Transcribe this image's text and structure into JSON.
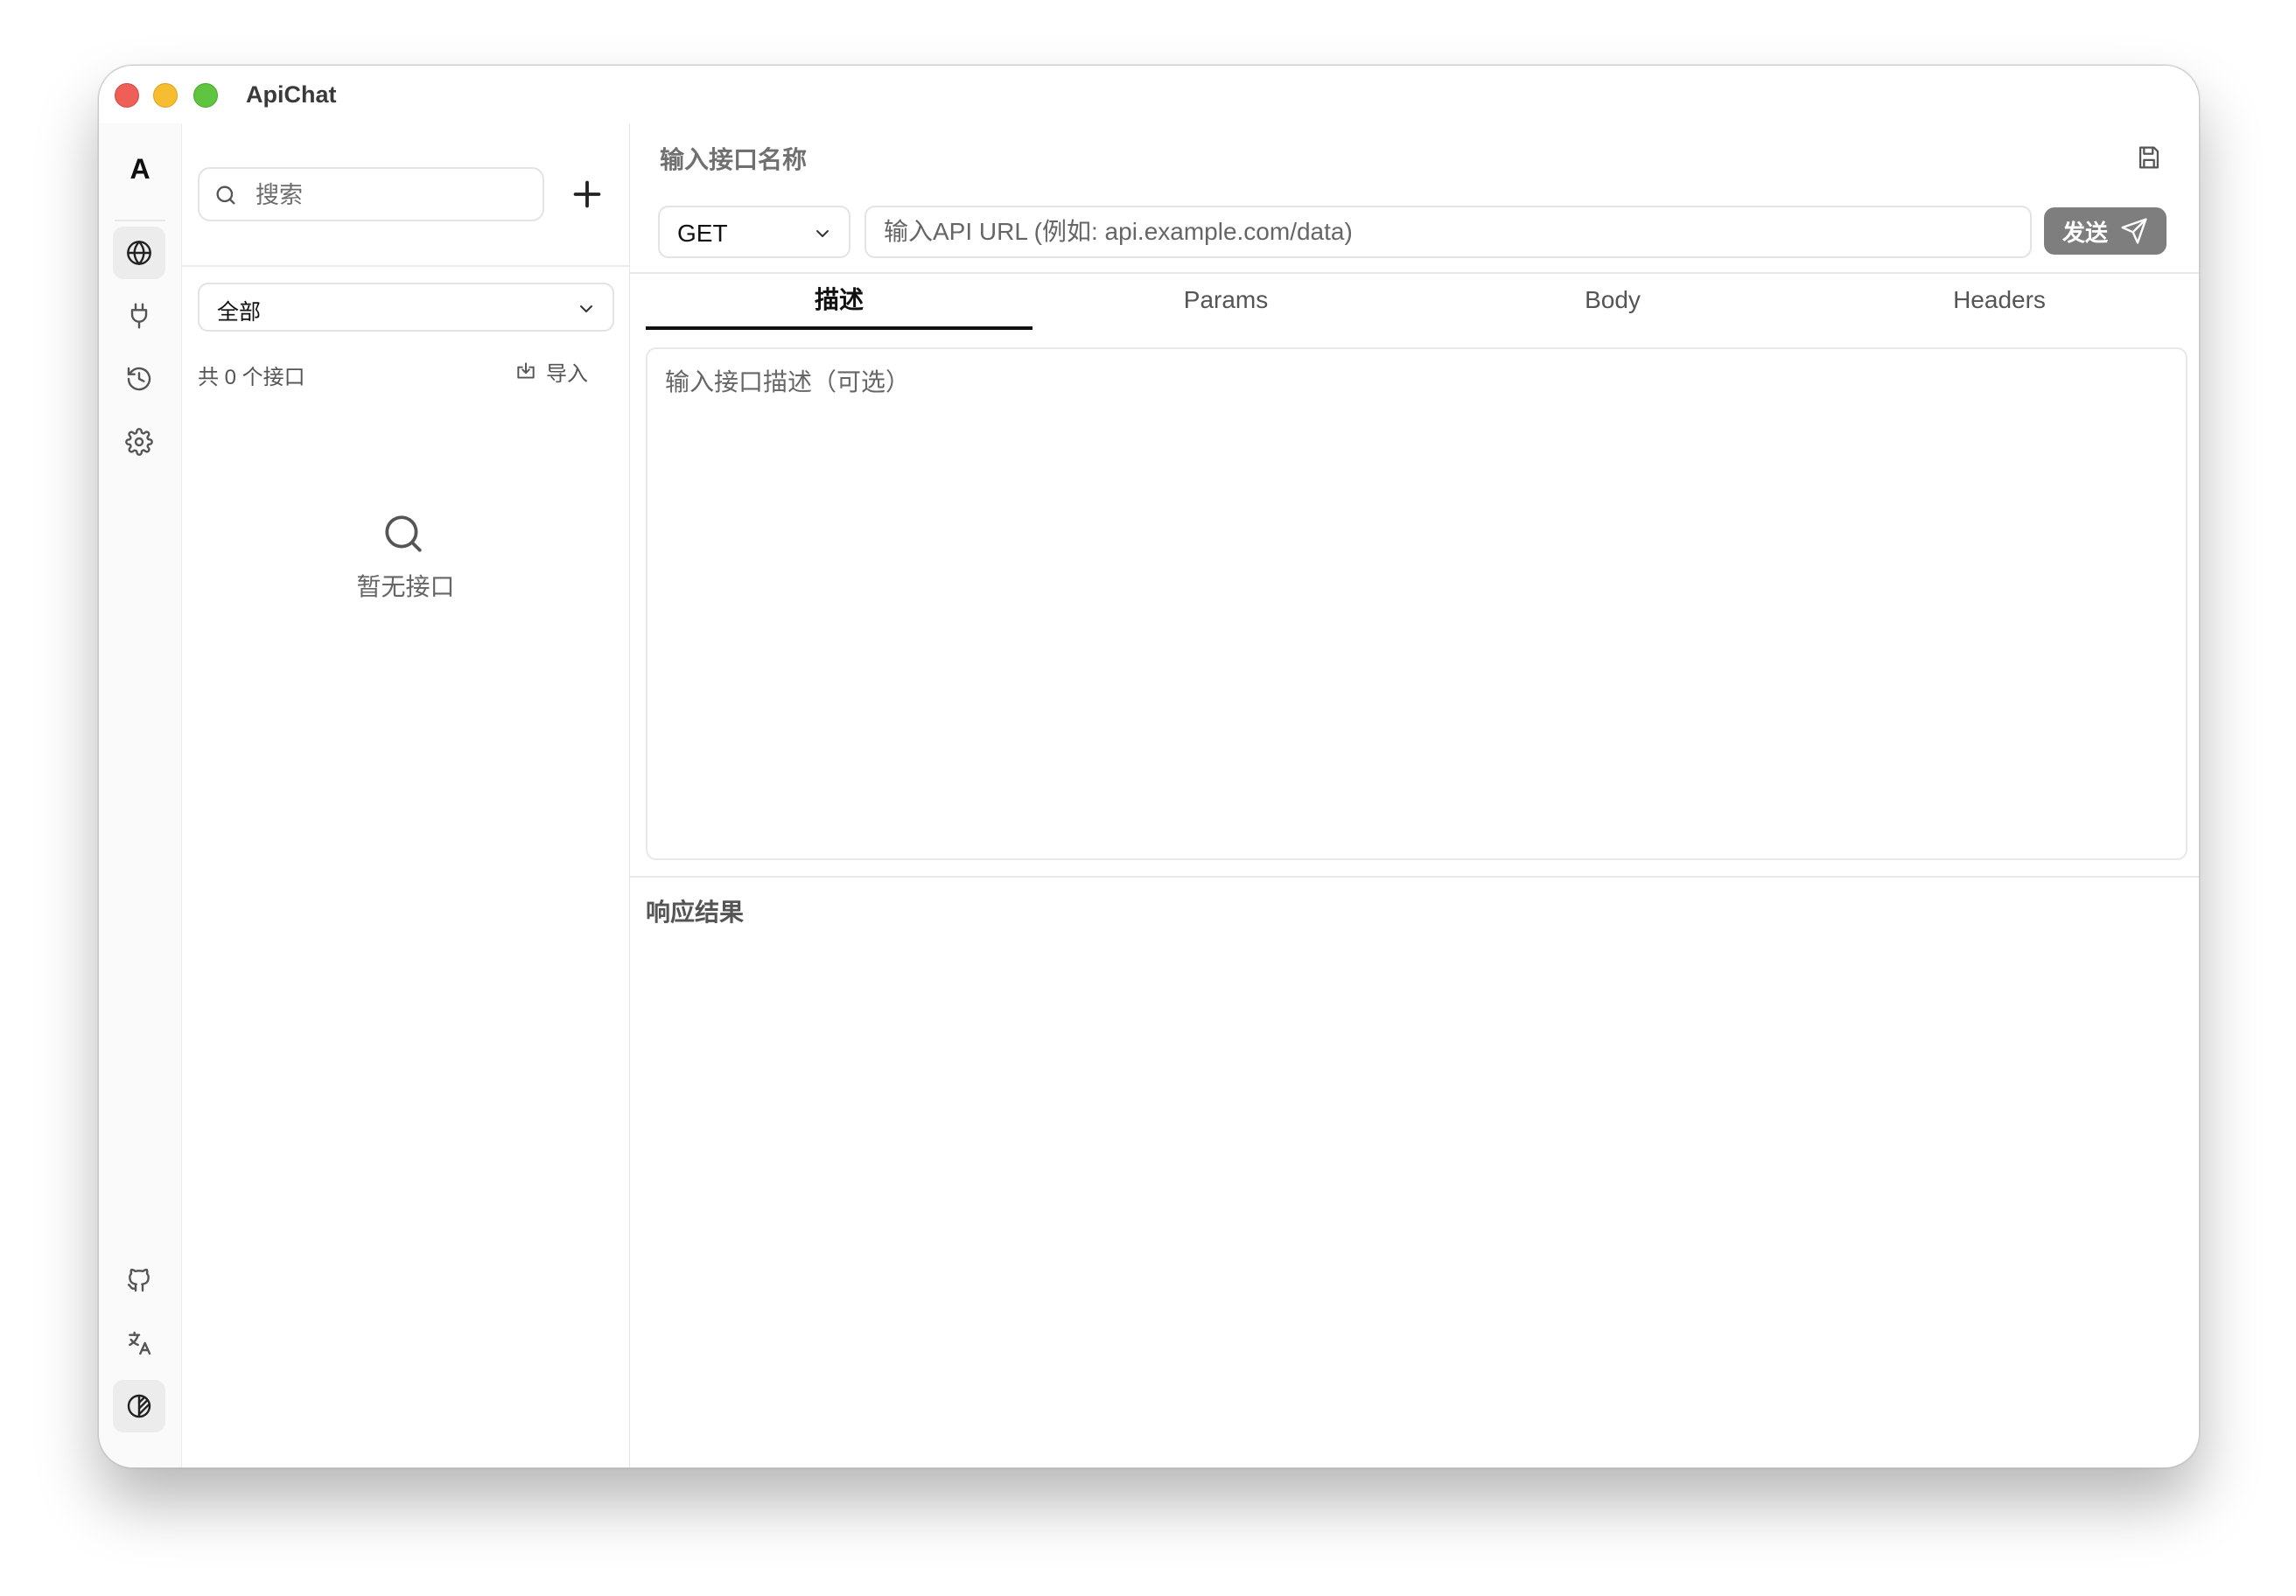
{
  "window": {
    "title": "ApiChat"
  },
  "rail": {
    "logo": "A",
    "top_icons": [
      "globe-icon",
      "plug-icon",
      "history-icon",
      "gear-icon"
    ],
    "bottom_icons": [
      "github-icon",
      "translate-icon",
      "theme-icon"
    ]
  },
  "list": {
    "search_placeholder": "搜索",
    "filter_value": "全部",
    "count_text": "共 0 个接口",
    "import_label": "导入",
    "empty_text": "暂无接口"
  },
  "request": {
    "name_placeholder": "输入接口名称",
    "method": "GET",
    "url_placeholder": "输入API URL (例如: api.example.com/data)",
    "send_label": "发送"
  },
  "tabs": [
    {
      "label": "描述",
      "active": true
    },
    {
      "label": "Params",
      "active": false
    },
    {
      "label": "Body",
      "active": false
    },
    {
      "label": "Headers",
      "active": false
    }
  ],
  "description": {
    "placeholder": "输入接口描述（可选）"
  },
  "response": {
    "title": "响应结果"
  }
}
